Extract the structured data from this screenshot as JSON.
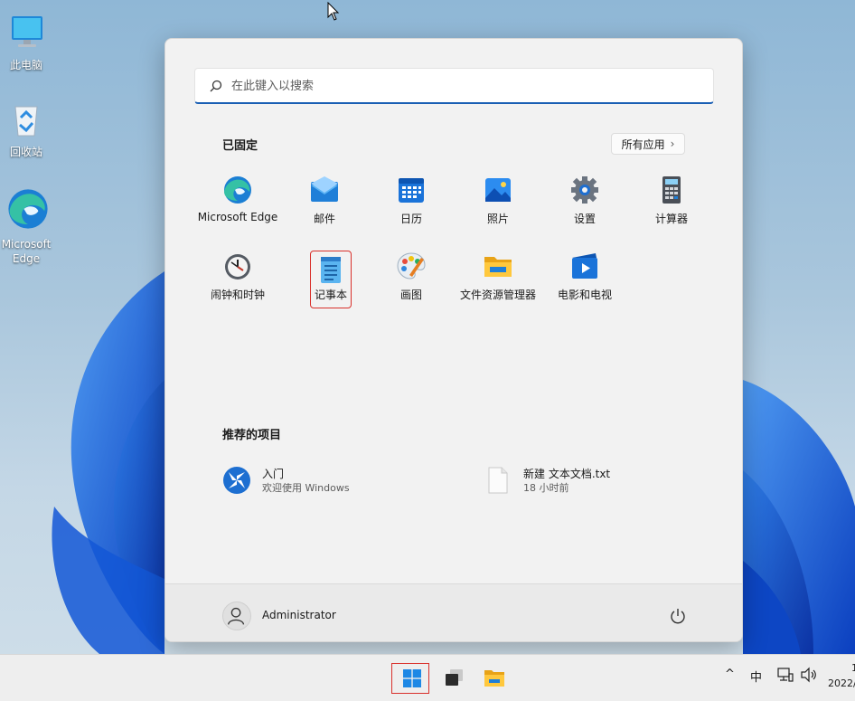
{
  "desktop": {
    "icons": [
      {
        "label": "此电脑",
        "icon": "monitor-icon"
      },
      {
        "label": "回收站",
        "icon": "recycle-bin-icon"
      },
      {
        "label": "Microsoft Edge",
        "icon": "edge-icon"
      }
    ]
  },
  "start_menu": {
    "search": {
      "placeholder": "在此键入以搜索",
      "value": ""
    },
    "pinned_title": "已固定",
    "all_apps_label": "所有应用",
    "pinned": [
      {
        "label": "Microsoft Edge",
        "icon": "edge-icon"
      },
      {
        "label": "邮件",
        "icon": "mail-icon"
      },
      {
        "label": "日历",
        "icon": "calendar-icon"
      },
      {
        "label": "照片",
        "icon": "photos-icon"
      },
      {
        "label": "设置",
        "icon": "gear-icon"
      },
      {
        "label": "计算器",
        "icon": "calculator-icon"
      },
      {
        "label": "闹钟和时钟",
        "icon": "clock-icon"
      },
      {
        "label": "记事本",
        "icon": "notepad-icon",
        "highlighted": true
      },
      {
        "label": "画图",
        "icon": "paint-icon"
      },
      {
        "label": "文件资源管理器",
        "icon": "folder-icon"
      },
      {
        "label": "电影和电视",
        "icon": "movies-icon"
      }
    ],
    "recommended_title": "推荐的项目",
    "recommended": [
      {
        "name": "入门",
        "subtitle": "欢迎使用 Windows",
        "icon": "get-started-icon"
      },
      {
        "name": "新建 文本文档.txt",
        "subtitle": "18 小时前",
        "icon": "text-file-icon"
      }
    ],
    "user": {
      "name": "Administrator"
    }
  },
  "taskbar": {
    "items": [
      {
        "name": "start",
        "icon": "windows-logo-icon"
      },
      {
        "name": "task-view",
        "icon": "task-view-icon"
      },
      {
        "name": "file-explorer",
        "icon": "folder-icon"
      }
    ],
    "tray": {
      "chevron": "^",
      "ime": "中"
    },
    "clock": {
      "time": "1",
      "date": "2022/"
    }
  },
  "colors": {
    "accent": "#1a5fb4",
    "highlight": "#d9302b"
  }
}
